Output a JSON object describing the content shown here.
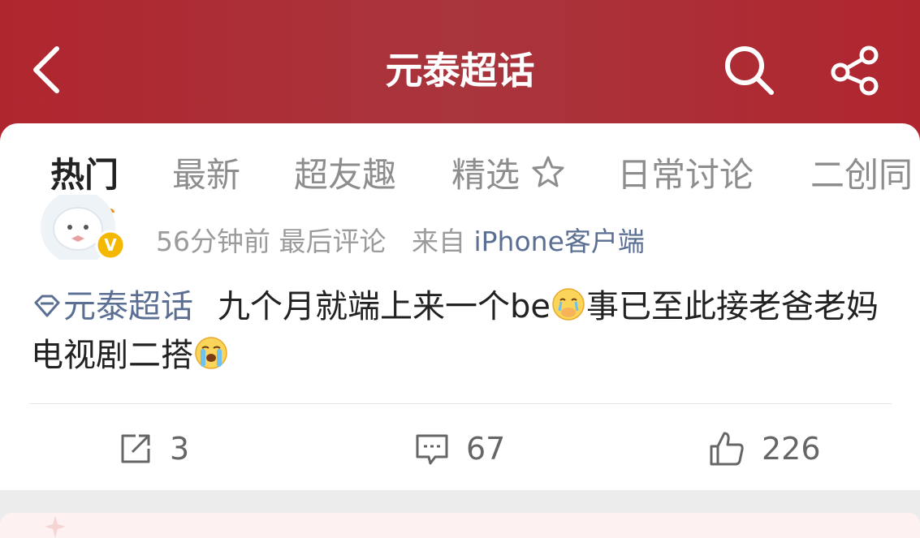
{
  "header": {
    "title": "元泰超话",
    "back_icon": "chevron-left-icon",
    "search_icon": "search-icon",
    "share_icon": "share-icon",
    "accent": "#b0262f"
  },
  "tabs": [
    {
      "label": "热门",
      "active": true
    },
    {
      "label": "最新",
      "active": false
    },
    {
      "label": "超友趣",
      "active": false
    },
    {
      "label": "精选",
      "active": false,
      "icon": "star-icon"
    },
    {
      "label": "日常讨论",
      "active": false
    },
    {
      "label": "二创同",
      "active": false
    }
  ],
  "post": {
    "avatar_icon": "avatar-with-verified-badge",
    "verified_badge": "V",
    "time": "56分钟前",
    "last_comment": "最后评论",
    "from_label": "来自",
    "source": "iPhone客户端",
    "topic": "元泰超话",
    "text_part1": "九个月就端上来一个be",
    "text_part2": "事已至此接老爸老妈电视剧二搭",
    "emoji1": "crying-covering-mouth-emoji",
    "emoji2": "loudly-crying-emoji"
  },
  "actions": {
    "repost_count": "3",
    "comment_count": "67",
    "like_count": "226"
  }
}
